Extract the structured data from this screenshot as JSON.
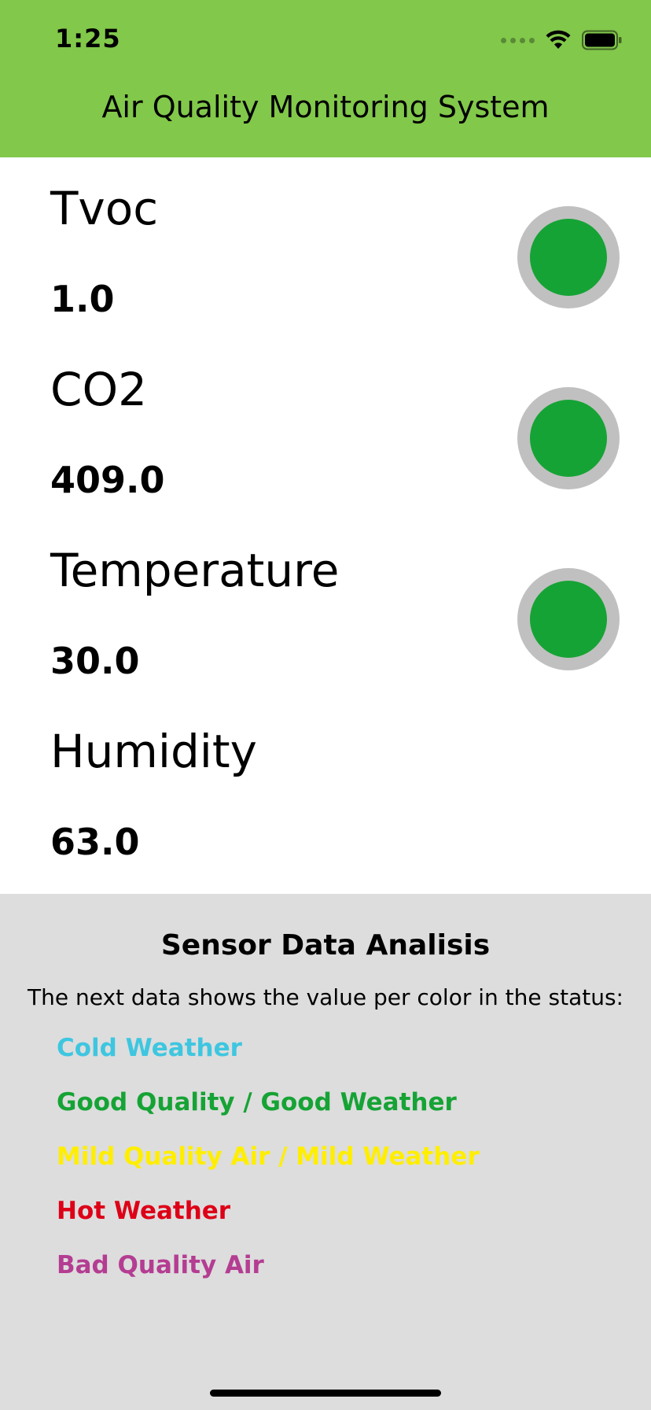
{
  "status_bar": {
    "time": "1:25",
    "wifi_icon": "wifi-icon",
    "battery_icon": "battery-icon"
  },
  "header": {
    "title": "Air Quality Monitoring System",
    "background": "#82c84b"
  },
  "readings": [
    {
      "label": "Tvoc",
      "value": "1.0",
      "status_color": "#16a335"
    },
    {
      "label": "CO2",
      "value": "409.0",
      "status_color": "#16a335"
    },
    {
      "label": "Temperature",
      "value": "30.0",
      "status_color": "#16a335"
    },
    {
      "label": "Humidity",
      "value": "63.0"
    }
  ],
  "analysis": {
    "title": "Sensor Data Analisis",
    "description": "The next data shows the value per color in the status:",
    "legend": [
      {
        "label": "Cold Weather",
        "color": "#3ec6e0"
      },
      {
        "label": "Good Quality / Good Weather",
        "color": "#16a335"
      },
      {
        "label": "Mild Quality Air / Mild Weather",
        "color": "#ffee00"
      },
      {
        "label": "Hot Weather",
        "color": "#dd0017"
      },
      {
        "label": "Bad Quality Air",
        "color": "#b43d92"
      }
    ]
  }
}
